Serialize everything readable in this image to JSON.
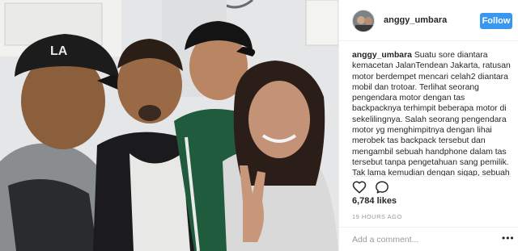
{
  "post": {
    "photo_alt": "",
    "header": {
      "username": "anggy_umbara",
      "follow_label": "Follow"
    },
    "caption": {
      "username": "anggy_umbara",
      "text": "Suatu sore diantara kemacetan JalanTendean Jakarta, ratusan motor berdempet mencari celah2 diantara mobil dan trotoar. Terlihat seorang pengendara motor dengan tas backpacknya terhimpit beberapa motor di sekelilingnya. Salah seorang pengendara motor yg menghimpitnya dengan lihai merobek tas backpack tersebut dan mengambil sebuah handphone dalam tas tersebut tanpa pengetahuan sang pemilik. Tak lama kemudian dengan sigap, sebuah"
    },
    "icons": {
      "like": "heart-icon",
      "comment": "comment-bubble-icon",
      "more": "more-options-icon"
    },
    "likes": "6,784 likes",
    "time": "19 HOURS AGO",
    "add_comment_placeholder": "Add a comment...",
    "more_label": "•••",
    "colors": {
      "follow_button": "#3897f0",
      "text": "#262626",
      "muted": "#999999",
      "divider": "#efefef"
    }
  }
}
